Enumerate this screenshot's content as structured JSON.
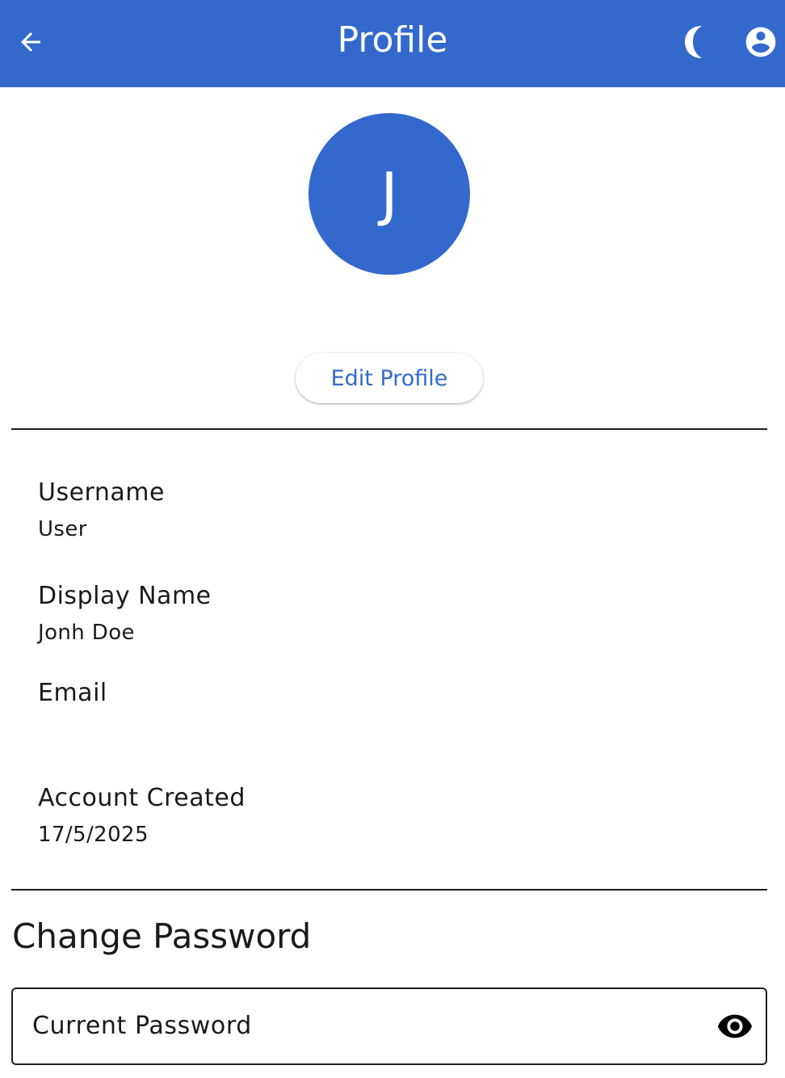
{
  "appbar": {
    "title": "Profile",
    "back_icon": "arrow-left-icon",
    "theme_icon": "moon-icon",
    "account_icon": "account-circle-icon",
    "background": "#3369cd"
  },
  "avatar": {
    "initial": "J"
  },
  "actions": {
    "edit_profile_label": "Edit Profile"
  },
  "fields": {
    "username_label": "Username",
    "username_value": "User",
    "display_name_label": "Display Name",
    "display_name_value": "Jonh Doe",
    "email_label": "Email",
    "email_value": "",
    "created_label": "Account Created",
    "created_value": "17/5/2025"
  },
  "change_password": {
    "title": "Change Password",
    "current_password_placeholder": "Current Password",
    "visibility_icon": "eye-icon"
  }
}
